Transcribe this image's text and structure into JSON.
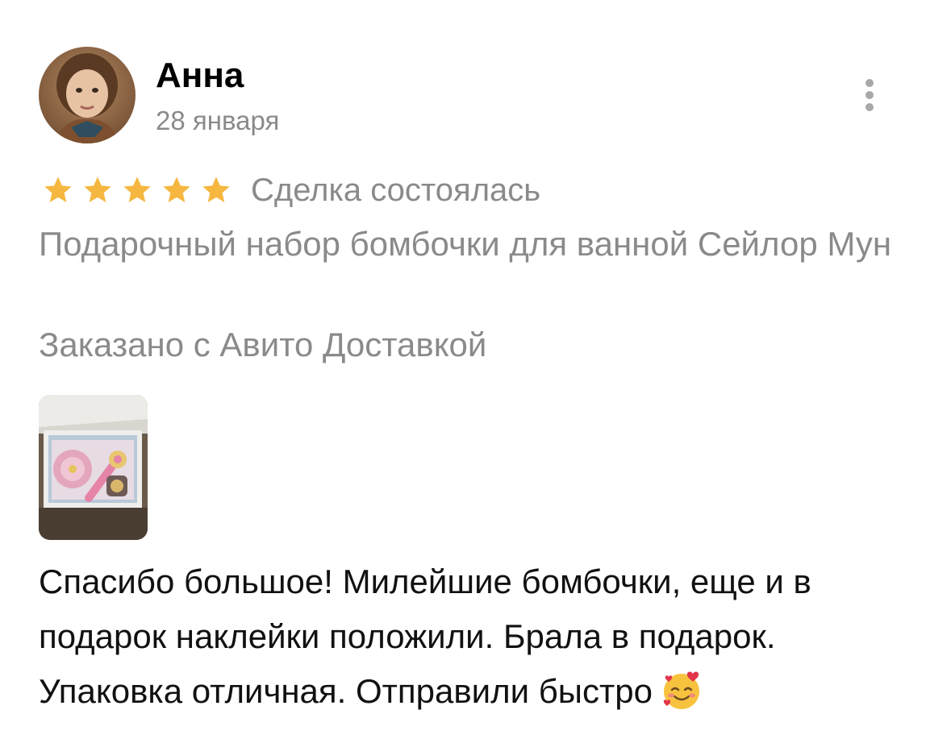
{
  "review": {
    "author": "Анна",
    "date": "28 января",
    "rating": 5,
    "rating_max": 5,
    "deal_status": "Сделка состоялась",
    "product_title": "Подарочный набор бомбочки для ванной Сейлор Мун",
    "delivery_note": "Заказано с Авито Доставкой",
    "text": "Спасибо большое! Милейшие бомбочки, еще и в подарок наклейки положили. Брала в подарок. Упаковка отличная. Отправили быстро",
    "emoji": "smiling-face-with-hearts"
  },
  "icons": {
    "more": "more-vertical-icon",
    "star": "star-icon"
  },
  "colors": {
    "star": "#F5B740",
    "secondary_text": "#8A8A8A",
    "primary_text": "#000000",
    "menu_dots": "#A8A8A8"
  }
}
